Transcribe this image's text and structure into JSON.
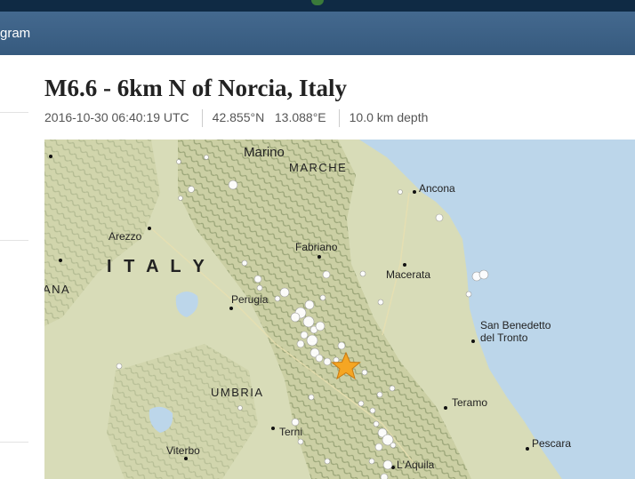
{
  "nav": {
    "label": "gram"
  },
  "event": {
    "title": "M6.6 - 6km N of Norcia, Italy",
    "time": "2016-10-30 06:40:19 UTC",
    "latitude": "42.855°N",
    "longitude": "13.088°E",
    "depth": "10.0 km depth"
  },
  "map": {
    "country_label": "I T A L Y",
    "regions": [
      "MARCHE",
      "UMBRIA"
    ],
    "region_fragments": [
      "ANA"
    ],
    "cities": [
      "Marino",
      "Ancona",
      "Arezzo",
      "Fabriano",
      "Macerata",
      "Perugia",
      "San Benedetto",
      "del Tronto",
      "Teramo",
      "Terni",
      "Viterbo",
      "Pescara",
      "L'Aquila"
    ],
    "colors": {
      "sea": "#bcd6ea",
      "land": "#d8dcb8",
      "epicenter": "#f5a623"
    },
    "epicenter_icon": "star-icon"
  }
}
